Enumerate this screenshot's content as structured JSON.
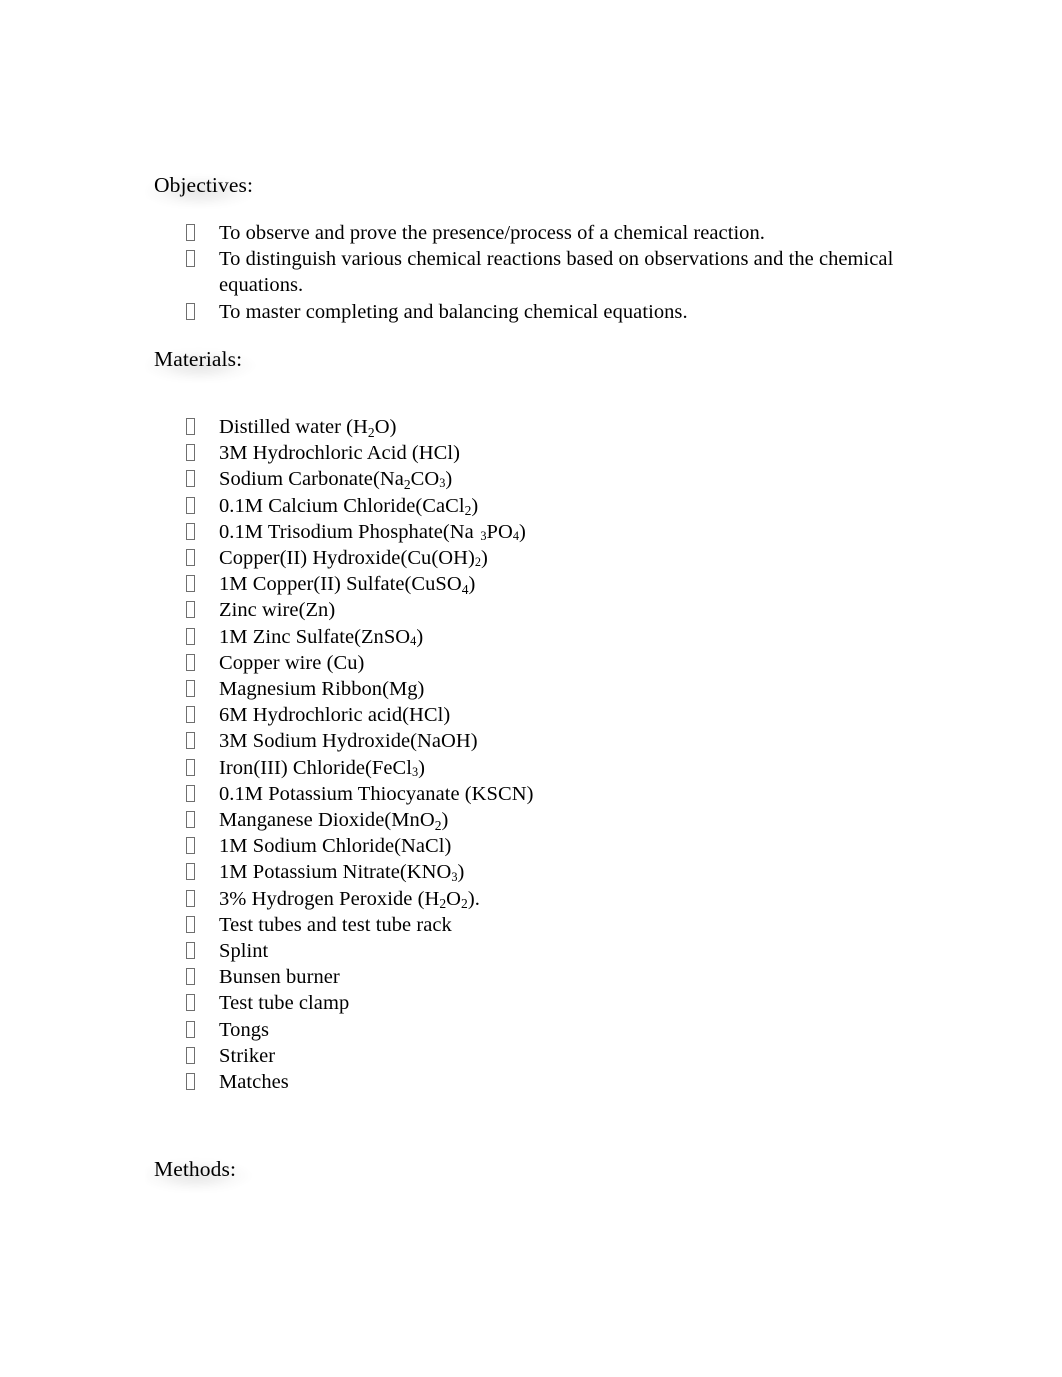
{
  "document": {
    "type": "lab-report-page",
    "page_background": "#ffffff",
    "text_color": "#000000",
    "bullet_glyph": "missing-glyph-box"
  },
  "sections": [
    {
      "id": "objectives",
      "heading": "Objectives:",
      "items": [
        "To observe and prove the presence/process of a chemical reaction.",
        "To distinguish various chemical reactions based on observations and the chemical equations.",
        "To master completing and balancing chemical equations."
      ]
    },
    {
      "id": "materials",
      "heading": "Materials:",
      "items": [
        "Distilled water (H2O)",
        "3M Hydrochloric Acid (HCl)",
        "Sodium Carbonate(Na2CO3)",
        "0.1M Calcium Chloride(CaCl2)",
        "0.1M Trisodium Phosphate(Na 3PO4)",
        "Copper(II) Hydroxide(Cu(OH)2)",
        "1M Copper(II) Sulfate(CuSO4)",
        "Zinc wire(Zn)",
        "1M Zinc Sulfate(ZnSO4)",
        "Copper wire (Cu)",
        "Magnesium Ribbon(Mg)",
        "6M Hydrochloric acid(HCl)",
        "3M Sodium Hydroxide(NaOH)",
        "Iron(III) Chloride(FeCl3)",
        "0.1M Potassium Thiocyanate (KSCN)",
        "Manganese Dioxide(MnO2)",
        "1M Sodium Chloride(NaCl)",
        "1M Potassium Nitrate(KNO3)",
        "3% Hydrogen Peroxide (H2O2).",
        "Test tubes and test tube rack",
        "Splint",
        "Bunsen burner",
        "Test tube clamp",
        "Tongs",
        "Striker",
        "Matches"
      ]
    },
    {
      "id": "methods",
      "heading": "Methods:",
      "items": []
    }
  ]
}
